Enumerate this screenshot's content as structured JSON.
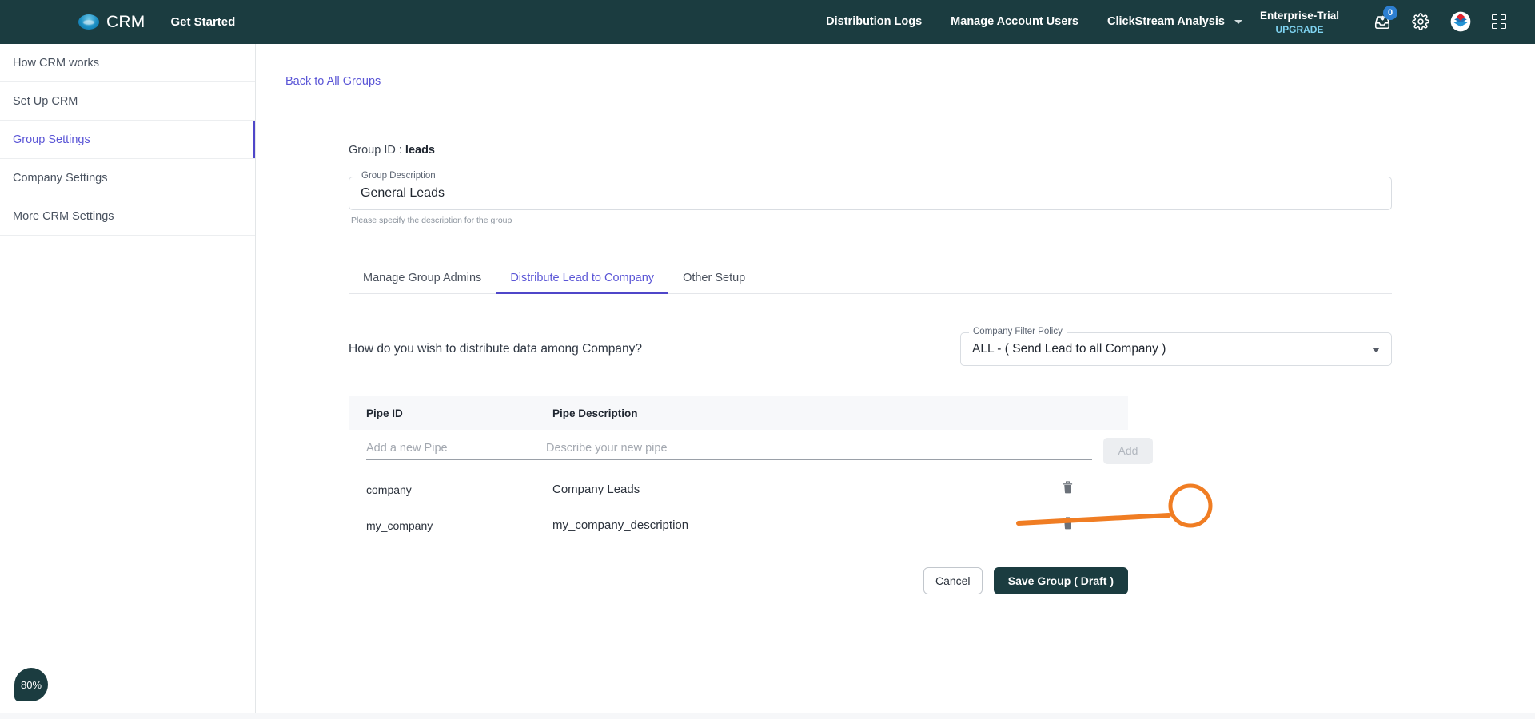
{
  "header": {
    "brand": "CRM",
    "get_started": "Get Started",
    "nav": [
      {
        "label": "Distribution Logs",
        "caret": false
      },
      {
        "label": "Manage Account Users",
        "caret": false
      },
      {
        "label": "ClickStream Analysis",
        "caret": true
      }
    ],
    "plan": "Enterprise-Trial",
    "upgrade": "UPGRADE",
    "notification_count": "0",
    "icons": {
      "inbox": "inbox-download-icon",
      "gear": "gear-icon",
      "zoho": "zoho-logo-icon",
      "apps": "app-grid-icon"
    },
    "colors": {
      "bar": "#1b3c40",
      "badge": "#2d7fd1",
      "upgrade_link": "#7fd3f0"
    }
  },
  "sidebar": {
    "items": [
      {
        "label": "How CRM works",
        "active": false
      },
      {
        "label": "Set Up CRM",
        "active": false
      },
      {
        "label": "Group Settings",
        "active": true
      },
      {
        "label": "Company Settings",
        "active": false
      },
      {
        "label": "More CRM Settings",
        "active": false
      }
    ],
    "active_color": "#5a55d6"
  },
  "main": {
    "back_link": "Back to All Groups",
    "group_id_label": "Group ID :",
    "group_id_value": "leads",
    "description_field": {
      "legend": "Group Description",
      "value": "General Leads",
      "help": "Please specify the description for the group"
    },
    "tabs": [
      {
        "label": "Manage Group Admins",
        "active": false
      },
      {
        "label": "Distribute Lead to Company",
        "active": true
      },
      {
        "label": "Other Setup",
        "active": false
      }
    ],
    "distribute": {
      "question": "How do you wish to distribute data among Company?",
      "policy_legend": "Company Filter Policy",
      "policy_value": "ALL - ( Send Lead to all Company )"
    },
    "table": {
      "columns": [
        "Pipe ID",
        "Pipe Description"
      ],
      "new_row": {
        "pipe_id_placeholder": "Add a new Pipe",
        "pipe_desc_placeholder": "Describe your new pipe",
        "pipe_id_value": "",
        "pipe_desc_value": "",
        "add_label": "Add"
      },
      "rows": [
        {
          "pipe_id": "company",
          "pipe_description": "Company Leads",
          "delete_icon": "trash-icon"
        },
        {
          "pipe_id": "my_company",
          "pipe_description": "my_company_description",
          "delete_icon": "trash-icon"
        }
      ]
    },
    "actions": {
      "cancel": "Cancel",
      "save": "Save Group ( Draft )"
    }
  },
  "progress_badge": {
    "value": "80%"
  },
  "annotation": {
    "color": "#F07D23",
    "target": "first-row-delete-icon"
  }
}
